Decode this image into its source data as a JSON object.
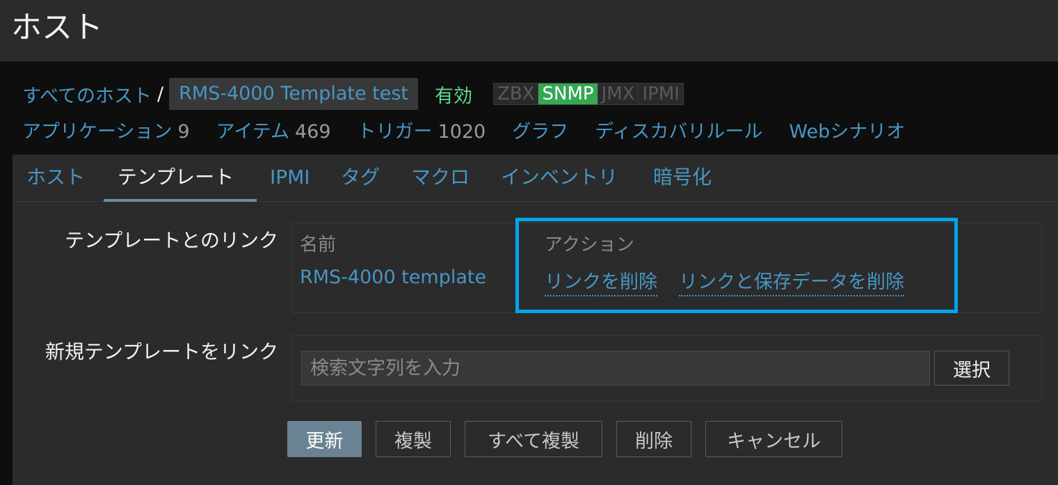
{
  "header": {
    "title": "ホスト"
  },
  "breadcrumb": {
    "all_hosts": "すべてのホスト",
    "separator": "/",
    "host_name": "RMS-4000 Template test",
    "status": "有効"
  },
  "availability": {
    "zbx": "ZBX",
    "snmp": "SNMP",
    "jmx": "JMX",
    "ipmi": "IPMI",
    "active": "SNMP"
  },
  "host_nav": {
    "applications": {
      "label": "アプリケーション",
      "count": "9"
    },
    "items": {
      "label": "アイテム",
      "count": "469"
    },
    "triggers": {
      "label": "トリガー",
      "count": "1020"
    },
    "graphs": {
      "label": "グラフ"
    },
    "discovery": {
      "label": "ディスカバリルール"
    },
    "web": {
      "label": "Webシナリオ"
    }
  },
  "tabs": [
    {
      "label": "ホスト"
    },
    {
      "label": "テンプレート",
      "active": true
    },
    {
      "label": "IPMI"
    },
    {
      "label": "タグ"
    },
    {
      "label": "マクロ"
    },
    {
      "label": "インベントリ"
    },
    {
      "label": "暗号化"
    }
  ],
  "linked_templates": {
    "label": "テンプレートとのリンク",
    "col_name": "名前",
    "col_action": "アクション",
    "template_name": "RMS-4000 template",
    "unlink": "リンクを削除",
    "unlink_clear": "リンクと保存データを削除"
  },
  "link_new": {
    "label": "新規テンプレートをリンク",
    "placeholder": "検索文字列を入力",
    "select": "選択"
  },
  "buttons": {
    "update": "更新",
    "clone": "複製",
    "full_clone": "すべて複製",
    "delete": "削除",
    "cancel": "キャンセル"
  },
  "colors": {
    "link": "#4796c4",
    "enabled": "#59db8f",
    "highlight": "#00a6e8",
    "primary_button": "#6a8393"
  }
}
